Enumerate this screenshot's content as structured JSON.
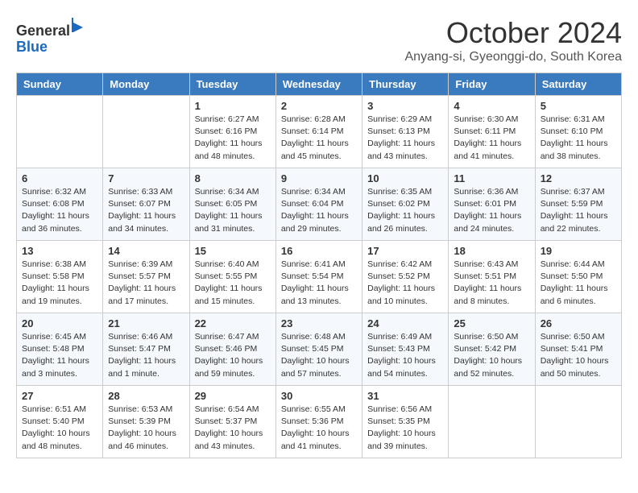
{
  "header": {
    "logo_line1": "General",
    "logo_line2": "Blue",
    "month_title": "October 2024",
    "location": "Anyang-si, Gyeonggi-do, South Korea"
  },
  "weekdays": [
    "Sunday",
    "Monday",
    "Tuesday",
    "Wednesday",
    "Thursday",
    "Friday",
    "Saturday"
  ],
  "weeks": [
    [
      {
        "day": "",
        "info": ""
      },
      {
        "day": "",
        "info": ""
      },
      {
        "day": "1",
        "info": "Sunrise: 6:27 AM\nSunset: 6:16 PM\nDaylight: 11 hours and 48 minutes."
      },
      {
        "day": "2",
        "info": "Sunrise: 6:28 AM\nSunset: 6:14 PM\nDaylight: 11 hours and 45 minutes."
      },
      {
        "day": "3",
        "info": "Sunrise: 6:29 AM\nSunset: 6:13 PM\nDaylight: 11 hours and 43 minutes."
      },
      {
        "day": "4",
        "info": "Sunrise: 6:30 AM\nSunset: 6:11 PM\nDaylight: 11 hours and 41 minutes."
      },
      {
        "day": "5",
        "info": "Sunrise: 6:31 AM\nSunset: 6:10 PM\nDaylight: 11 hours and 38 minutes."
      }
    ],
    [
      {
        "day": "6",
        "info": "Sunrise: 6:32 AM\nSunset: 6:08 PM\nDaylight: 11 hours and 36 minutes."
      },
      {
        "day": "7",
        "info": "Sunrise: 6:33 AM\nSunset: 6:07 PM\nDaylight: 11 hours and 34 minutes."
      },
      {
        "day": "8",
        "info": "Sunrise: 6:34 AM\nSunset: 6:05 PM\nDaylight: 11 hours and 31 minutes."
      },
      {
        "day": "9",
        "info": "Sunrise: 6:34 AM\nSunset: 6:04 PM\nDaylight: 11 hours and 29 minutes."
      },
      {
        "day": "10",
        "info": "Sunrise: 6:35 AM\nSunset: 6:02 PM\nDaylight: 11 hours and 26 minutes."
      },
      {
        "day": "11",
        "info": "Sunrise: 6:36 AM\nSunset: 6:01 PM\nDaylight: 11 hours and 24 minutes."
      },
      {
        "day": "12",
        "info": "Sunrise: 6:37 AM\nSunset: 5:59 PM\nDaylight: 11 hours and 22 minutes."
      }
    ],
    [
      {
        "day": "13",
        "info": "Sunrise: 6:38 AM\nSunset: 5:58 PM\nDaylight: 11 hours and 19 minutes."
      },
      {
        "day": "14",
        "info": "Sunrise: 6:39 AM\nSunset: 5:57 PM\nDaylight: 11 hours and 17 minutes."
      },
      {
        "day": "15",
        "info": "Sunrise: 6:40 AM\nSunset: 5:55 PM\nDaylight: 11 hours and 15 minutes."
      },
      {
        "day": "16",
        "info": "Sunrise: 6:41 AM\nSunset: 5:54 PM\nDaylight: 11 hours and 13 minutes."
      },
      {
        "day": "17",
        "info": "Sunrise: 6:42 AM\nSunset: 5:52 PM\nDaylight: 11 hours and 10 minutes."
      },
      {
        "day": "18",
        "info": "Sunrise: 6:43 AM\nSunset: 5:51 PM\nDaylight: 11 hours and 8 minutes."
      },
      {
        "day": "19",
        "info": "Sunrise: 6:44 AM\nSunset: 5:50 PM\nDaylight: 11 hours and 6 minutes."
      }
    ],
    [
      {
        "day": "20",
        "info": "Sunrise: 6:45 AM\nSunset: 5:48 PM\nDaylight: 11 hours and 3 minutes."
      },
      {
        "day": "21",
        "info": "Sunrise: 6:46 AM\nSunset: 5:47 PM\nDaylight: 11 hours and 1 minute."
      },
      {
        "day": "22",
        "info": "Sunrise: 6:47 AM\nSunset: 5:46 PM\nDaylight: 10 hours and 59 minutes."
      },
      {
        "day": "23",
        "info": "Sunrise: 6:48 AM\nSunset: 5:45 PM\nDaylight: 10 hours and 57 minutes."
      },
      {
        "day": "24",
        "info": "Sunrise: 6:49 AM\nSunset: 5:43 PM\nDaylight: 10 hours and 54 minutes."
      },
      {
        "day": "25",
        "info": "Sunrise: 6:50 AM\nSunset: 5:42 PM\nDaylight: 10 hours and 52 minutes."
      },
      {
        "day": "26",
        "info": "Sunrise: 6:50 AM\nSunset: 5:41 PM\nDaylight: 10 hours and 50 minutes."
      }
    ],
    [
      {
        "day": "27",
        "info": "Sunrise: 6:51 AM\nSunset: 5:40 PM\nDaylight: 10 hours and 48 minutes."
      },
      {
        "day": "28",
        "info": "Sunrise: 6:53 AM\nSunset: 5:39 PM\nDaylight: 10 hours and 46 minutes."
      },
      {
        "day": "29",
        "info": "Sunrise: 6:54 AM\nSunset: 5:37 PM\nDaylight: 10 hours and 43 minutes."
      },
      {
        "day": "30",
        "info": "Sunrise: 6:55 AM\nSunset: 5:36 PM\nDaylight: 10 hours and 41 minutes."
      },
      {
        "day": "31",
        "info": "Sunrise: 6:56 AM\nSunset: 5:35 PM\nDaylight: 10 hours and 39 minutes."
      },
      {
        "day": "",
        "info": ""
      },
      {
        "day": "",
        "info": ""
      }
    ]
  ]
}
